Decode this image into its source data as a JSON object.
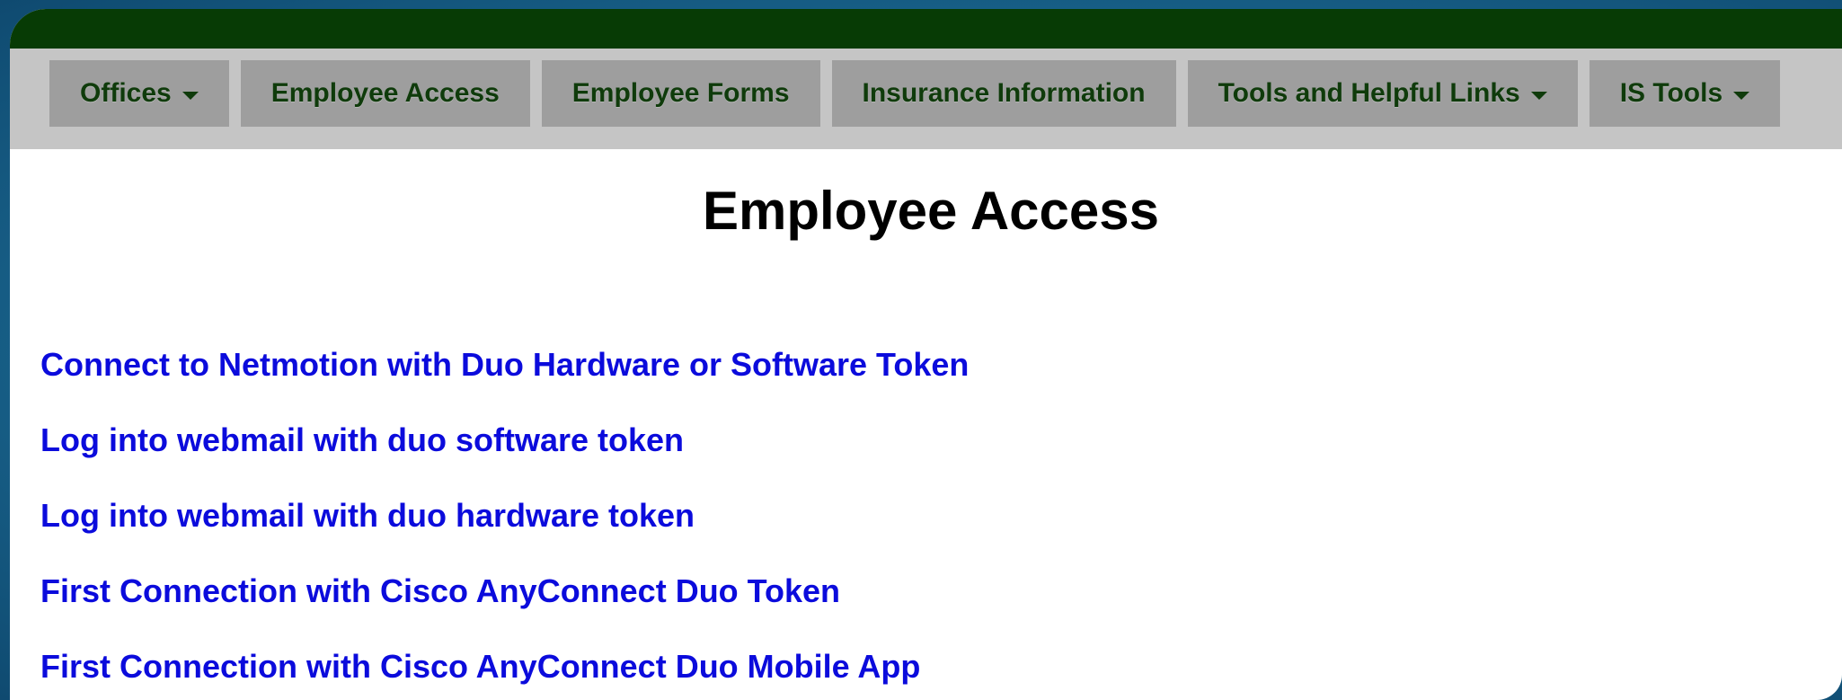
{
  "nav": {
    "items": [
      {
        "label": "Offices",
        "dropdown": true
      },
      {
        "label": "Employee Access",
        "dropdown": false
      },
      {
        "label": "Employee Forms",
        "dropdown": false
      },
      {
        "label": "Insurance Information",
        "dropdown": false
      },
      {
        "label": "Tools and Helpful Links",
        "dropdown": true
      },
      {
        "label": "IS Tools",
        "dropdown": true
      }
    ]
  },
  "page": {
    "title": "Employee Access"
  },
  "links": [
    "Connect to Netmotion with Duo Hardware or Software Token",
    "Log into webmail with duo software token",
    "Log into webmail with duo hardware token",
    "First Connection with Cisco AnyConnect Duo Token",
    "First Connection with Cisco AnyConnect Duo Mobile App"
  ],
  "colors": {
    "top_band": "#073b05",
    "nav_band": "#c5c5c5",
    "nav_item": "#9e9e9e",
    "nav_text": "#0f3b0b",
    "link": "#0b0bdc",
    "background": "#1d6d96"
  }
}
